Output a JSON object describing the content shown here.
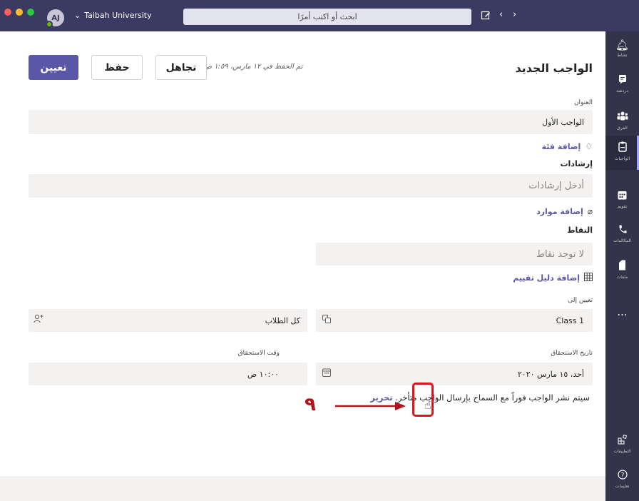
{
  "titlebar": {
    "avatar_initials": "AJ",
    "org_name": "Taibah University",
    "search_placeholder": "ابحث أو اكتب أمرًا",
    "icons": [
      "compose-icon",
      "back-icon",
      "forward-icon"
    ]
  },
  "rail": {
    "items": [
      {
        "icon": "bell-icon",
        "label": "نشاط"
      },
      {
        "icon": "chat-icon",
        "label": "دردشة"
      },
      {
        "icon": "teams-icon",
        "label": "الفرق"
      },
      {
        "icon": "assignments-icon",
        "label": "الواجبات",
        "active": true
      },
      {
        "icon": "calendar-icon",
        "label": "تقويم"
      },
      {
        "icon": "calls-icon",
        "label": "المكالمات"
      },
      {
        "icon": "files-icon",
        "label": "ملفات"
      }
    ],
    "more": "...",
    "bottom": [
      {
        "icon": "apps-icon",
        "label": "التطبيقات"
      },
      {
        "icon": "help-icon",
        "label": "تعليمات"
      }
    ]
  },
  "header": {
    "page_title": "الواجب الجديد",
    "saved_status": "تم الحفظ في ١٢ مارس، ١:٥٩ ص",
    "discard_label": "تجاهل",
    "save_label": "حفظ",
    "assign_label": "تعيين"
  },
  "form": {
    "title_label": "العنوان",
    "title_value": "الواجب الأول",
    "add_category": "إضافة فئة",
    "instructions_label": "إرشادات",
    "instructions_placeholder": "أدخل إرشادات",
    "add_resources": "إضافة موارد",
    "points_label": "النقاط",
    "points_placeholder": "لا توجد نقاط",
    "add_rubric": "إضافة دليل تقييم",
    "assign_to_label": "تعيين إلى",
    "class_value": "Class 1",
    "students_value": "كل الطلاب",
    "due_date_label": "تاريخ الاستحقاق",
    "due_date_value": "أحد، ١٥ مارس ٢٠٢٠",
    "due_time_label": "وقت الاستحقاق",
    "due_time_value": "١٠:٠٠ ص",
    "note_text": "سيتم نشر الواجب فوراً مع السماح بإرسال الواجب متأخر.",
    "note_edit": "تحرير"
  },
  "annotation": {
    "number": "٩",
    "color": "#e0121a"
  },
  "colors": {
    "titlebar": "#3b3a63",
    "rail": "#33344a",
    "accent": "#5b57a8",
    "field_bg": "#f3f2f1"
  }
}
